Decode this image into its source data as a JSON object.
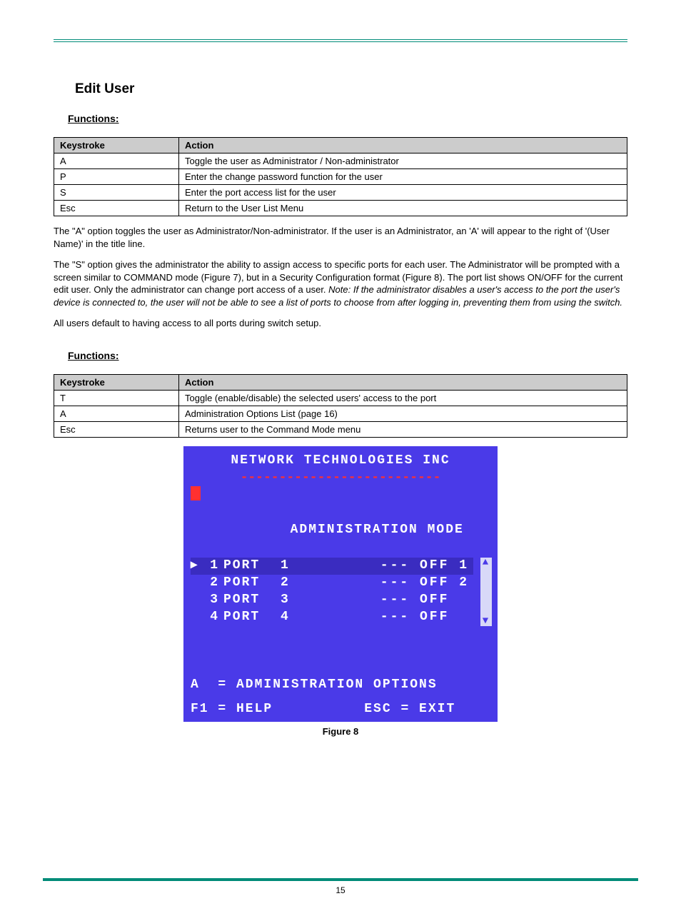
{
  "header": {
    "section_title": "Edit User"
  },
  "edit_user": {
    "subhead": "Functions:",
    "table": {
      "head_key": "Keystroke",
      "head_act": "Action",
      "rows": [
        {
          "key": "A",
          "action": "Toggle the user as Administrator / Non-administrator"
        },
        {
          "key": "P",
          "action": "Enter the change password function for the user"
        },
        {
          "key": "S",
          "action": "Enter the port access list for the user"
        },
        {
          "key": "Esc",
          "action": "Return to the User List Menu"
        }
      ]
    },
    "para1": "The \"A\" option toggles the user as Administrator/Non-administrator.  If the user is an Administrator, an 'A' will appear to the right of '(User Name)' in the title line.",
    "para2_prefix": "The \"S\" option gives the administrator the ability to assign access to specific ports for each user.  The Administrator will be prompted with a screen similar to COMMAND mode (Figure 7), but in a Security Configuration format (Figure 8).  The port list shows ON/OFF for the current edit user.  Only the administrator can change port access of a user.",
    "para2_note_label": "Note:",
    "para2_note": " If the administrator disables a user's access to the port the user's device is connected to, the user will not be able to see a list of ports to choose from after logging in, preventing them from using the switch.",
    "para3": "All users default to having access to all ports during switch setup."
  },
  "port_access": {
    "subhead": "Functions:",
    "table": {
      "head_key": "Keystroke",
      "head_act": "Action",
      "rows": [
        {
          "key": "T",
          "action": "Toggle (enable/disable)  the selected users' access to the port"
        },
        {
          "key": "A",
          "action": "Administration Options List (page 16)"
        },
        {
          "key": "Esc",
          "action": "Returns user to the Command Mode menu"
        }
      ]
    }
  },
  "terminal": {
    "company": "NETWORK TECHNOLOGIES INC",
    "dashes": "--------------------------",
    "mode": "ADMINISTRATION MODE",
    "ports": [
      {
        "n": "1",
        "label": "PORT",
        "num": "1",
        "status": "--- OFF 1",
        "selected": true
      },
      {
        "n": "2",
        "label": "PORT",
        "num": "2",
        "status": "--- OFF 2",
        "selected": false
      },
      {
        "n": "3",
        "label": "PORT",
        "num": "3",
        "status": "--- OFF  ",
        "selected": false
      },
      {
        "n": "4",
        "label": "PORT",
        "num": "4",
        "status": "--- OFF  ",
        "selected": false
      }
    ],
    "opt_line": "A  = ADMINISTRATION OPTIONS",
    "help_line": "F1 = HELP          ESC = EXIT"
  },
  "figure": {
    "caption": "Figure 8"
  },
  "page_number": "15"
}
